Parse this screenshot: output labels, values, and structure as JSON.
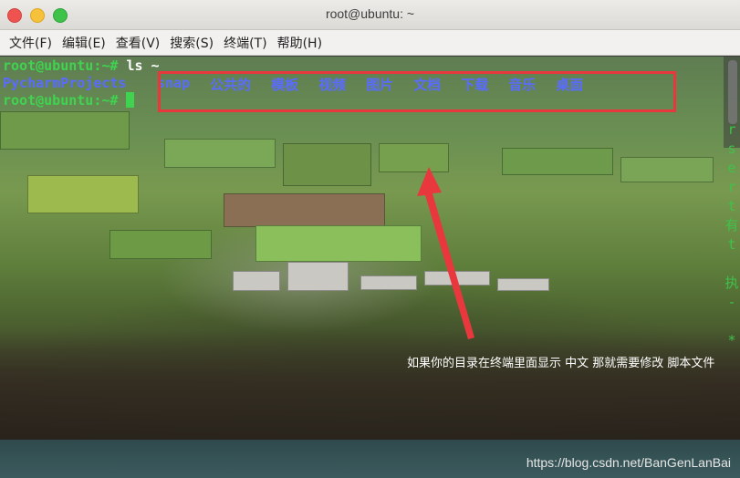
{
  "window": {
    "title": "root@ubuntu: ~"
  },
  "menu": [
    "文件(F)",
    "编辑(E)",
    "查看(V)",
    "搜索(S)",
    "终端(T)",
    "帮助(H)"
  ],
  "terminal": {
    "line1_prompt": "root@ubuntu:~#",
    "line1_cmd": " ls ~",
    "line2_first": "PycharmProjects",
    "directories": [
      "snap",
      "公共的",
      "模板",
      "视频",
      "图片",
      "文档",
      "下载",
      "音乐",
      "桌面"
    ],
    "line3_prompt": "root@ubuntu:~#",
    "right_column": [
      "r",
      "s",
      "e",
      "r",
      "t",
      "有",
      "t",
      "",
      "执",
      "-",
      "",
      "*"
    ]
  },
  "annotation": {
    "caption": "如果你的目录在终端里面显示 中文 那就需要修改 脚本文件"
  },
  "watermark": "https://blog.csdn.net/BanGenLanBai",
  "colors": {
    "prompt": "#3fd34f",
    "directory": "#5a6bff",
    "annotation": "#e8383d"
  }
}
